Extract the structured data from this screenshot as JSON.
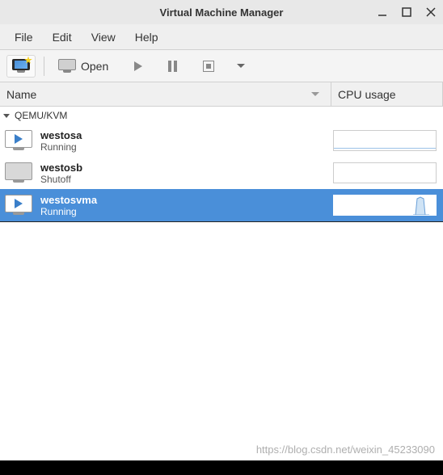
{
  "window": {
    "title": "Virtual Machine Manager"
  },
  "menu": {
    "file": "File",
    "edit": "Edit",
    "view": "View",
    "help": "Help"
  },
  "toolbar": {
    "open": "Open"
  },
  "columns": {
    "name": "Name",
    "cpu": "CPU usage"
  },
  "connection": {
    "label": "QEMU/KVM"
  },
  "vms": [
    {
      "name": "westosa",
      "status": "Running",
      "running": true,
      "selected": false,
      "spike": false
    },
    {
      "name": "westosb",
      "status": "Shutoff",
      "running": false,
      "selected": false,
      "spike": false
    },
    {
      "name": "westosvma",
      "status": "Running",
      "running": true,
      "selected": true,
      "spike": true
    }
  ],
  "watermark": "https://blog.csdn.net/weixin_45233090"
}
